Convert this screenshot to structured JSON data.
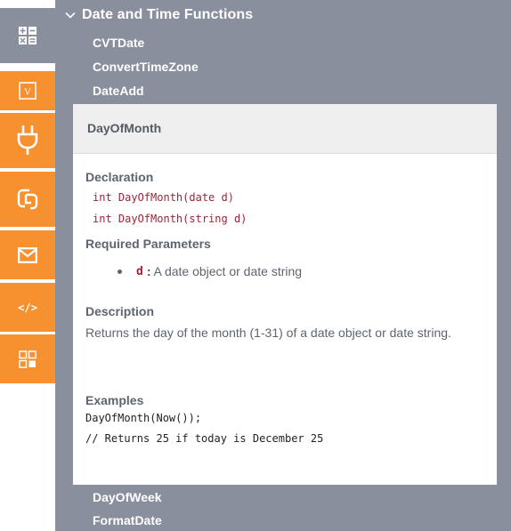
{
  "rail": {
    "items": [
      {
        "icon": "calculator-icon",
        "color": "#8a8f9d",
        "selected": true
      },
      {
        "icon": "variable-icon",
        "label": "V",
        "color": "#f7902f"
      },
      {
        "icon": "plug-icon",
        "color": "#f7902f"
      },
      {
        "icon": "link-function-icon",
        "color": "#f7902f"
      },
      {
        "icon": "mail-icon",
        "color": "#f7902f"
      },
      {
        "icon": "code-icon",
        "label": "</>",
        "color": "#f7902f"
      },
      {
        "icon": "apps-grid-icon",
        "color": "#f7902f"
      }
    ]
  },
  "section": {
    "title": "Date and Time Functions",
    "expanded": true
  },
  "functions_before": [
    "CVTDate",
    "ConvertTimeZone",
    "DateAdd"
  ],
  "detail": {
    "title": "DayOfMonth",
    "declaration_label": "Declaration",
    "declarations": [
      "int DayOfMonth(date d)",
      "int DayOfMonth(string d)"
    ],
    "required_params_label": "Required Parameters",
    "param_name": "d",
    "param_sep": ":",
    "param_desc": "A date object or date string",
    "description_label": "Description",
    "description": "Returns the day of the month (1-31) of a date object or date string.",
    "examples_label": "Examples",
    "examples": [
      "DayOfMonth(Now());",
      "// Returns 25 if today is December 25"
    ]
  },
  "functions_after": [
    "DayOfWeek",
    "FormatDate"
  ],
  "colors": {
    "panel": "#8a8f9d",
    "accent": "#f7902f",
    "code_red": "#a3233a"
  }
}
